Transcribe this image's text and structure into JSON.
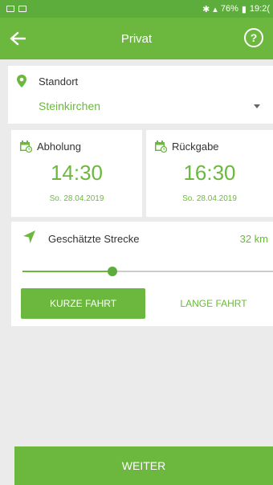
{
  "status_bar": {
    "battery": "76%",
    "time": "19:2("
  },
  "app_bar": {
    "title": "Privat",
    "help_label": "?"
  },
  "standort": {
    "label": "Standort",
    "value": "Steinkirchen"
  },
  "pickup": {
    "label": "Abholung",
    "time": "14:30",
    "date": "So. 28.04.2019"
  },
  "return": {
    "label": "Rückgabe",
    "time": "16:30",
    "date": "So. 28.04.2019"
  },
  "distance": {
    "label": "Geschätzte Strecke",
    "value": "32 km",
    "slider_fraction": 0.36
  },
  "trip_type": {
    "short_label": "KURZE FAHRT",
    "long_label": "LANGE FAHRT",
    "selected": "short"
  },
  "footer": {
    "next_label": "WEITER"
  },
  "colors": {
    "primary": "#6cb83f",
    "statusbar": "#5cad3b",
    "background": "#ebebeb"
  },
  "icons": [
    "back-arrow-icon",
    "help-icon",
    "location-pin-icon",
    "calendar-icon",
    "navigation-arrow-icon",
    "dropdown-caret-icon"
  ]
}
